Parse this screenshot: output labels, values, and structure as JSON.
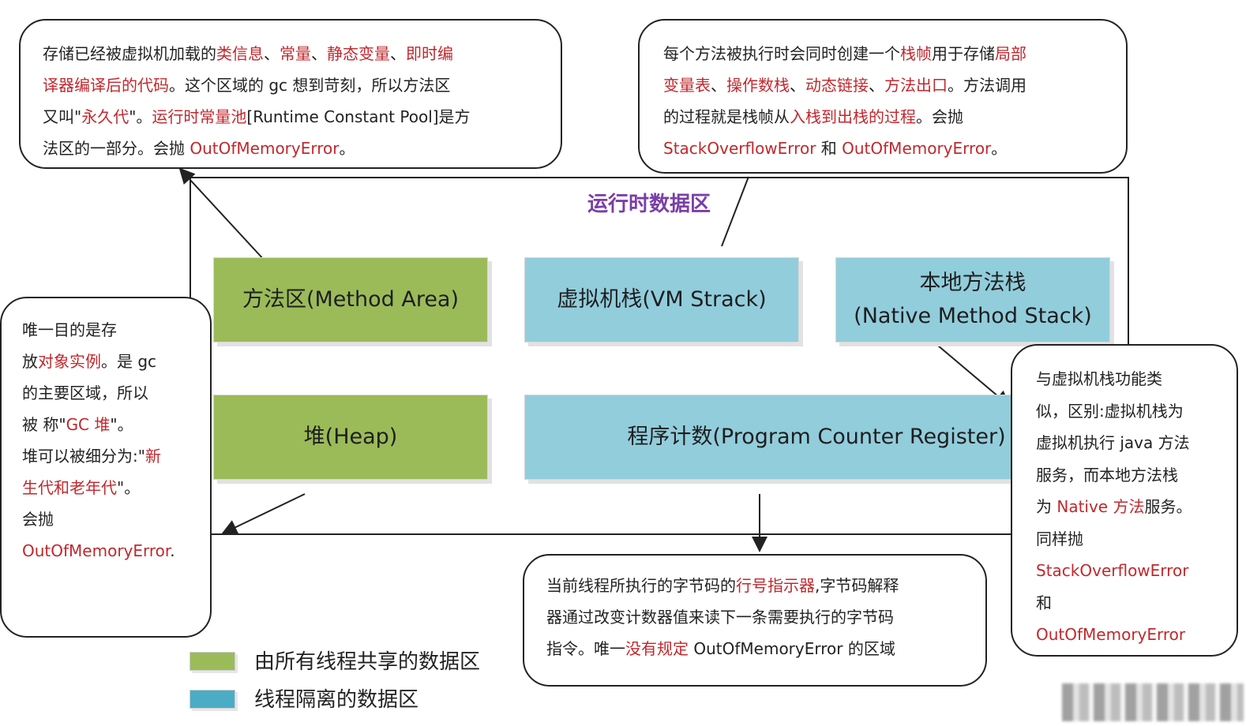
{
  "title": "运行时数据区",
  "regions": {
    "method_area": "方法区(Method Area)",
    "vm_stack": "虚拟机栈(VM Strack)",
    "native_stack_line1": "本地方法栈",
    "native_stack_line2": "(Native Method Stack)",
    "heap": "堆(Heap)",
    "pc_register": "程序计数(Program Counter Register)"
  },
  "callouts": {
    "method_area": [
      [
        "存储已经被虚拟机加载的",
        "类信息",
        "、",
        "常量",
        "、",
        "静态变量",
        "、",
        "即时编"
      ],
      [
        "译器编译后的代码",
        "。这个区域的 gc 想到苛刻，所以方法区"
      ],
      [
        "又叫\"",
        "永久代",
        "\"。",
        "运行时常量池",
        "[Runtime Constant Pool]是方"
      ],
      [
        "法区的一部分。会抛 ",
        "OutOfMemoryError",
        "。"
      ]
    ],
    "vm_stack": [
      [
        "每个方法被执行时会同时创建一个",
        "栈帧",
        "用于存储",
        "局部"
      ],
      [
        "变量表",
        "、",
        "操作数栈",
        "、",
        "动态链接",
        "、",
        "方法出口",
        "。方法调用"
      ],
      [
        "的过程就是栈帧从",
        "入栈到出栈的过程",
        "。会抛"
      ],
      [
        "StackOverflowError",
        " 和 ",
        "OutOfMemoryError",
        "。"
      ]
    ],
    "heap": [
      [
        "唯一目的是存"
      ],
      [
        "放",
        "对象实例",
        "。是 gc"
      ],
      [
        "的主要区域，所以"
      ],
      [
        "被 称\"",
        "GC 堆",
        "\"。"
      ],
      [
        "堆可以被细分为:\"",
        "新"
      ],
      [
        "生代和老年代",
        "\"。"
      ],
      [
        "会抛"
      ],
      [
        "OutOfMemoryError",
        "."
      ]
    ],
    "pc_register": [
      [
        "当前线程所执行的字节码的",
        "行号指示器",
        ",字节码解释"
      ],
      [
        "器通过改变计数器值来读下一条需要执行的字节码"
      ],
      [
        "指令。唯一",
        "没有规定",
        " OutOfMemoryError 的区域"
      ]
    ],
    "native_stack": [
      [
        "与虚拟机栈功能类"
      ],
      [
        "似，区别:虚拟机栈为"
      ],
      [
        "虚拟机执行 java 方法"
      ],
      [
        "服务，而本地方法栈"
      ],
      [
        "为 ",
        "Native 方法",
        "服务。"
      ],
      [
        "同样抛"
      ],
      [
        "StackOverflowError"
      ],
      [
        "和"
      ],
      [
        "OutOfMemoryError"
      ]
    ]
  },
  "legend": {
    "shared_label": "由所有线程共享的数据区",
    "isolated_label": "线程隔离的数据区",
    "shared_color": "#9bbb59",
    "isolated_color": "#4bacc6"
  },
  "colors": {
    "highlight": "#c0282d",
    "title": "#7a3ea8"
  }
}
